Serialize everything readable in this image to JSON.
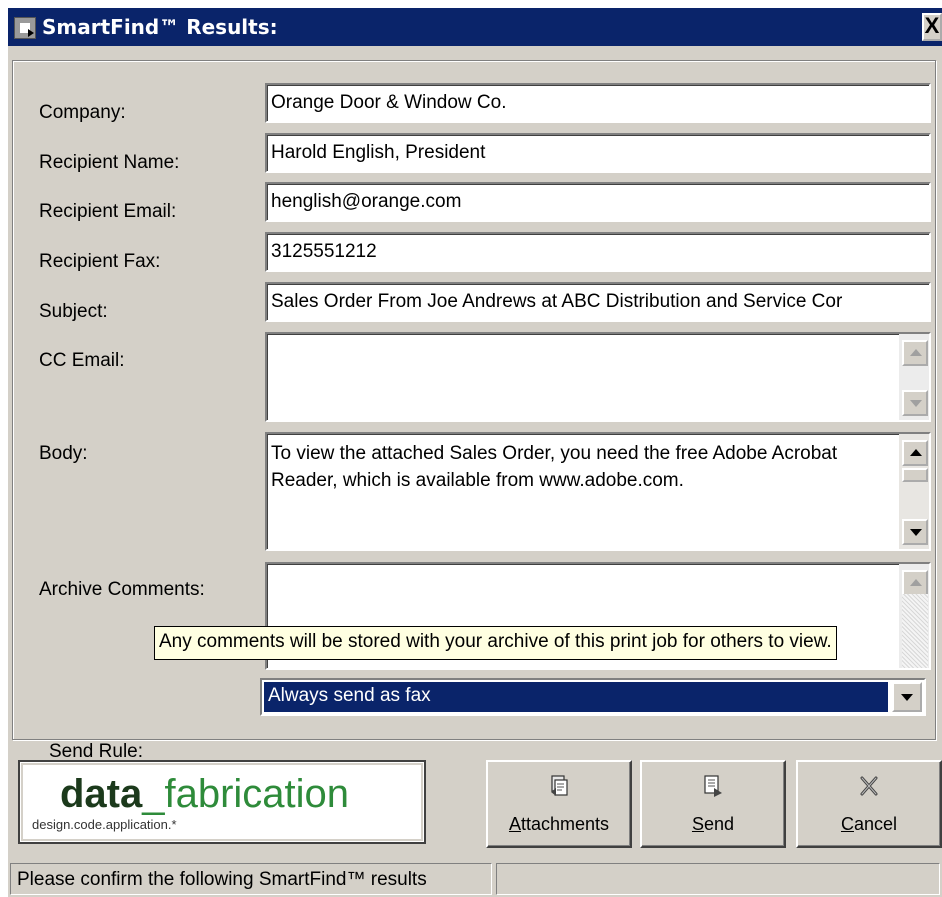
{
  "window": {
    "title": "SmartFind™ Results:",
    "close_label": "X"
  },
  "form": {
    "company": {
      "label": "Company:",
      "value": "Orange Door & Window Co."
    },
    "recipient_name": {
      "label": "Recipient Name:",
      "value": "Harold English, President"
    },
    "recipient_email": {
      "label": "Recipient Email:",
      "value": "henglish@orange.com"
    },
    "recipient_fax": {
      "label": "Recipient Fax:",
      "value": "3125551212"
    },
    "subject": {
      "label": "Subject:",
      "value": "Sales Order From Joe Andrews at ABC Distribution and Service Cor"
    },
    "cc_email": {
      "label": "CC Email:",
      "value": ""
    },
    "body": {
      "label": "Body:",
      "value": "To view the attached Sales Order, you need the free Adobe Acrobat Reader, which is available from www.adobe.com."
    },
    "archive_comments": {
      "label": "Archive Comments:",
      "value": ""
    },
    "send_rule": {
      "label": "Send Rule:",
      "value": "Always send as fax"
    }
  },
  "tooltip": "Any comments will be stored with your archive of this print job for others to view.",
  "logo": {
    "bold": "data",
    "rest": "_fabrication",
    "tagline": "design.code.application.*"
  },
  "buttons": {
    "attachments": {
      "mnemonic": "A",
      "rest": "ttachments",
      "icon": "attachments-icon"
    },
    "send": {
      "mnemonic": "S",
      "rest": "end",
      "icon": "send-icon"
    },
    "cancel": {
      "mnemonic": "C",
      "rest": "ancel",
      "icon": "cancel-x-icon"
    }
  },
  "status": {
    "message": "Please confirm the following SmartFind™ results"
  },
  "colors": {
    "titlebar": "#0a246a",
    "face": "#d4d0c8",
    "tooltip_bg": "#ffffe1",
    "logo_green": "#2e8b3a"
  }
}
